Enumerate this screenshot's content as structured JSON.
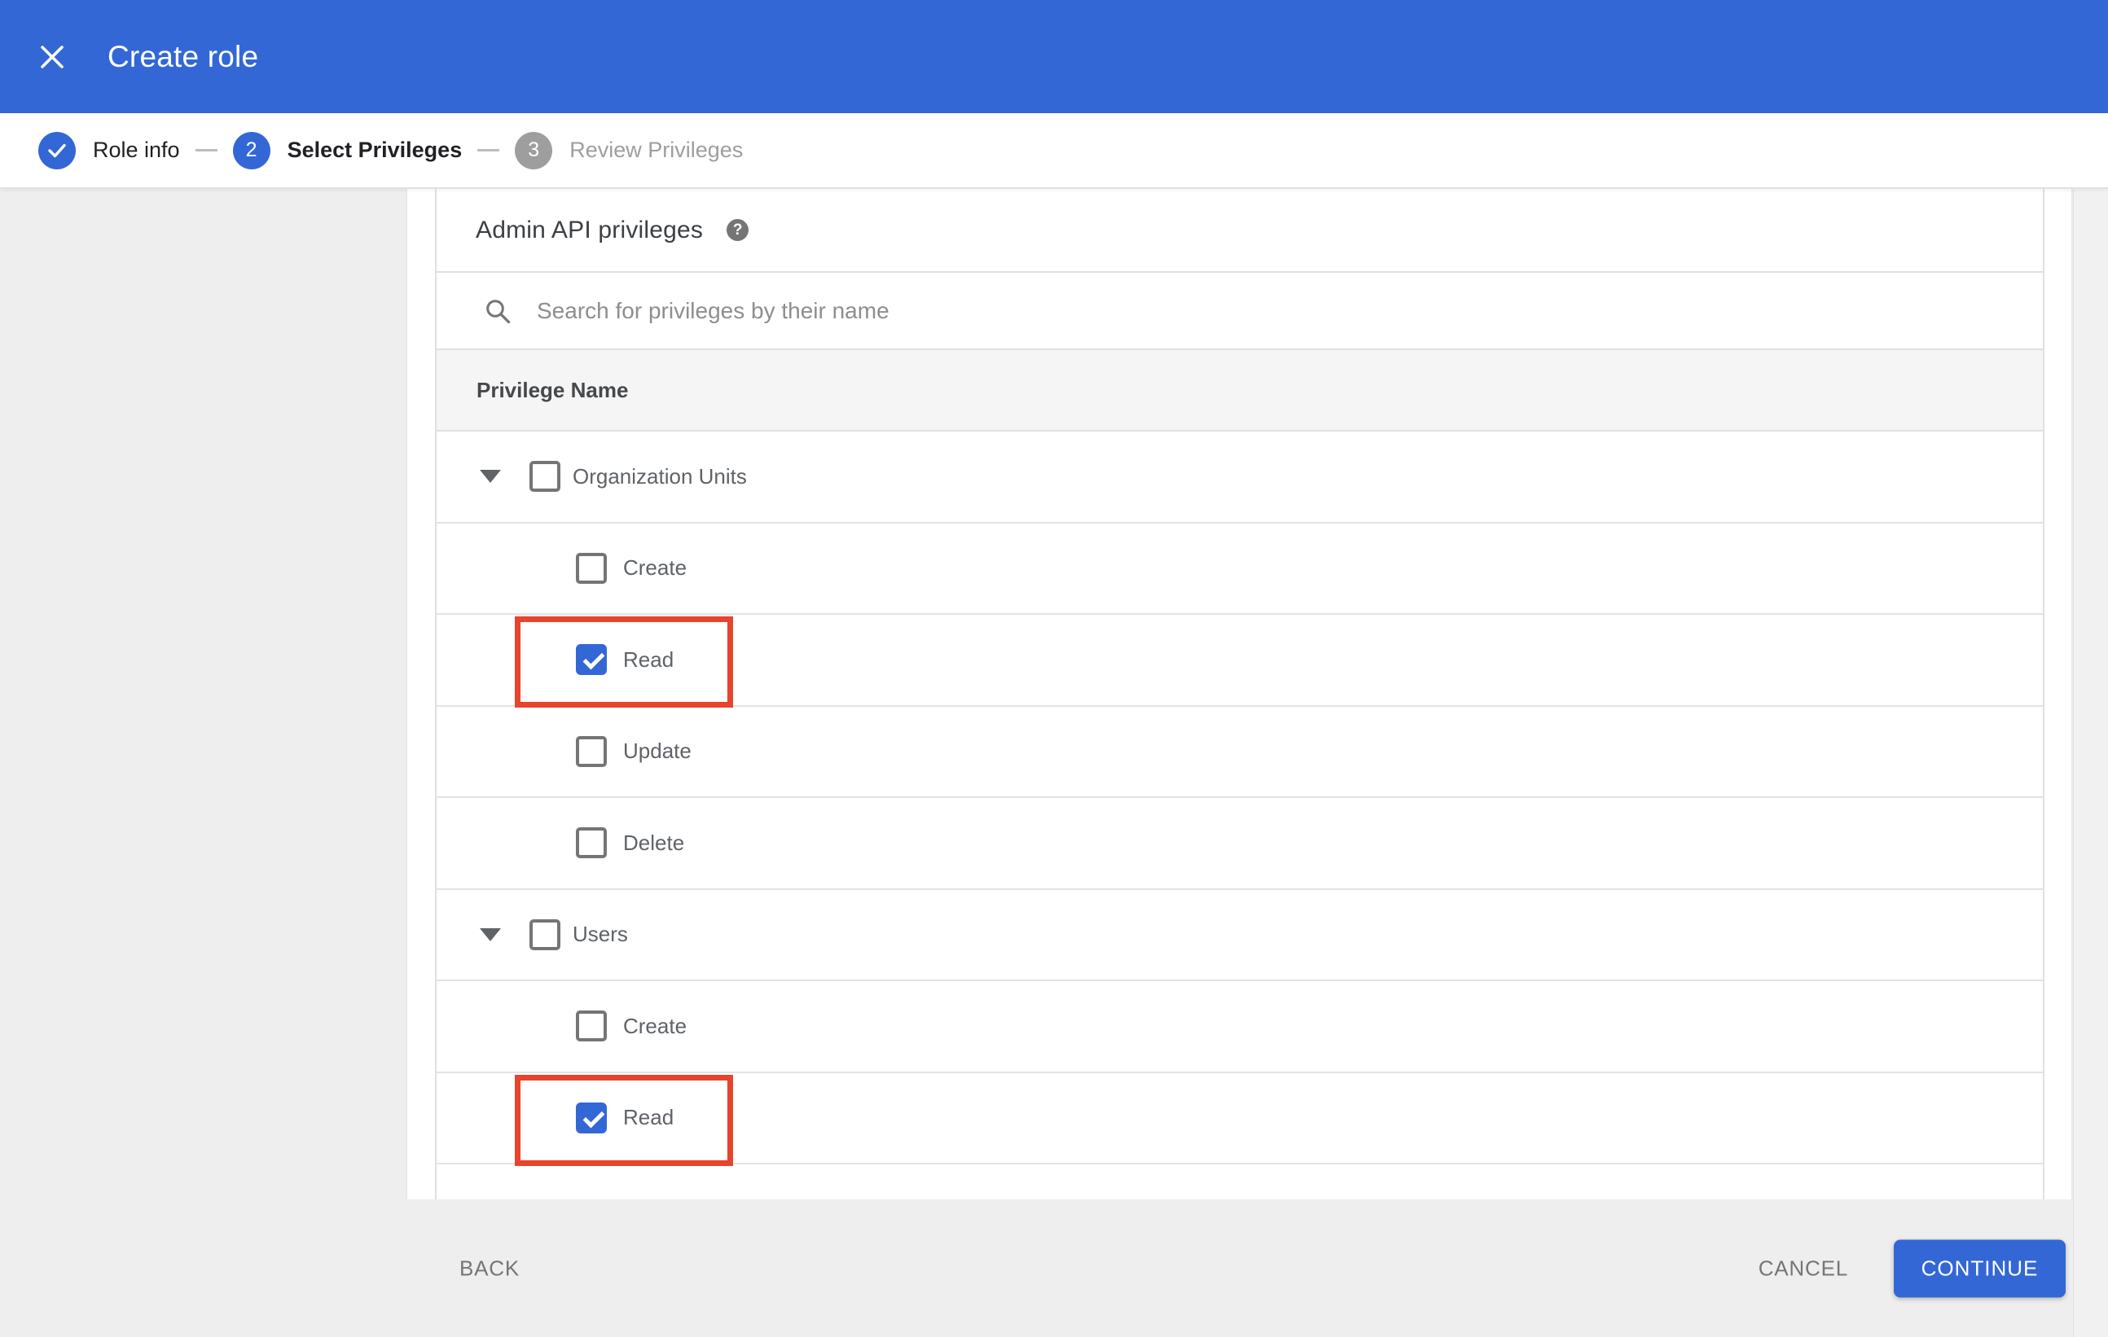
{
  "colors": {
    "header_blue": "#3367D6",
    "accent_blue": "#3367D6",
    "highlight_red": "#E8432C",
    "page_background": "#EEEEEE",
    "table_header_bg": "#F5F5F5"
  },
  "app_header": {
    "title": "Create role",
    "close_icon": "x-icon"
  },
  "stepper": {
    "steps": [
      {
        "label": "Role info",
        "state": "completed",
        "icon": "check-icon"
      },
      {
        "number": "2",
        "label": "Select Privileges",
        "state": "active"
      },
      {
        "number": "3",
        "label": "Review Privileges",
        "state": "upcoming"
      }
    ]
  },
  "content": {
    "section_title": "Admin API privileges",
    "help_glyph": "?",
    "search_placeholder": "Search for privileges by their name",
    "table": {
      "column_header": "Privilege Name",
      "rows": [
        {
          "label": "Organization Units",
          "type": "group",
          "checked": false,
          "highlighted": false
        },
        {
          "label": "Create",
          "type": "child",
          "checked": false,
          "highlighted": false
        },
        {
          "label": "Read",
          "type": "child",
          "checked": true,
          "highlighted": true
        },
        {
          "label": "Update",
          "type": "child",
          "checked": false,
          "highlighted": false
        },
        {
          "label": "Delete",
          "type": "child",
          "checked": false,
          "highlighted": false
        },
        {
          "label": "Users",
          "type": "group",
          "checked": false,
          "highlighted": false
        },
        {
          "label": "Create",
          "type": "child",
          "checked": false,
          "highlighted": false
        },
        {
          "label": "Read",
          "type": "child",
          "checked": true,
          "highlighted": true
        }
      ]
    }
  },
  "footer": {
    "back": "BACK",
    "cancel": "CANCEL",
    "continue": "CONTINUE"
  }
}
